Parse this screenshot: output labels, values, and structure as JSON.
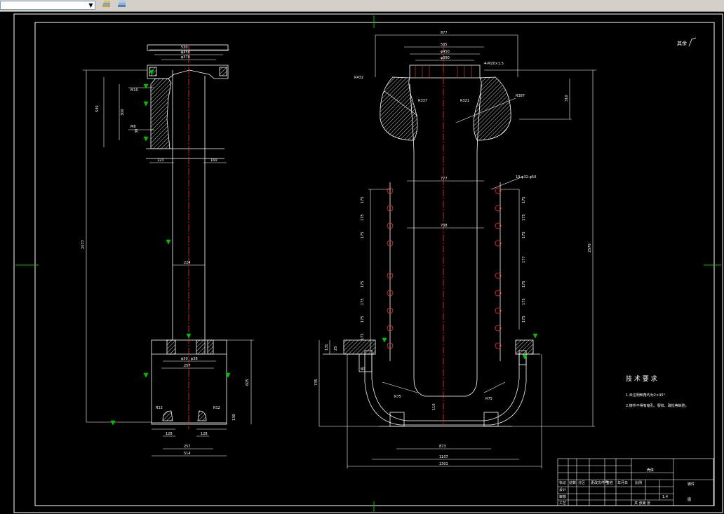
{
  "toolbar": {
    "combo_value": "",
    "layer_icon": "layer-stack-icon",
    "properties_icon": "layer-properties-icon"
  },
  "drawing": {
    "roughness_note": "其余",
    "tech_title": "技 术 要 求",
    "tech_items": [
      "1.未注明倒角均为2×45°",
      "2.铸件不得有缩孔、裂纹、疏松等缺陷。"
    ],
    "left_view": {
      "top_widths": [
        "530",
        "φ450",
        "φ370"
      ],
      "left_dims": [
        "530",
        "300",
        "M10",
        "M8",
        "30"
      ],
      "bottom_top": [
        "123",
        "160"
      ],
      "mid_width": "224",
      "lower_dims": [
        "φ30",
        "φ38",
        "257"
      ],
      "base_dims": [
        "R12",
        "R12",
        "128",
        "128",
        "257",
        "514"
      ],
      "height_dims": [
        "2577",
        "605",
        "130"
      ]
    },
    "right_view": {
      "top_widths": [
        "877",
        "535",
        "φ450",
        "φ390"
      ],
      "note_top": "4-M20×1.5",
      "radii": [
        "R432",
        "R387",
        "R337",
        "R321"
      ],
      "inner_widths": [
        "777",
        "708"
      ],
      "hole_note": "10-φ32-φ50",
      "left_dims": [
        "175",
        "175",
        "175",
        "175",
        "175",
        "175",
        "175"
      ],
      "right_dims": [
        "175",
        "175",
        "175",
        "177",
        "175",
        "175",
        "175"
      ],
      "bottom_dims": [
        "R75",
        "R75",
        "873",
        "1107",
        "1301"
      ],
      "height_dims": [
        "2570",
        "735",
        "310",
        "110"
      ],
      "side_dims": [
        "131",
        "25",
        "80"
      ]
    },
    "title_block": {
      "name": "壳体",
      "scale_label": "比例",
      "scale": "1:4",
      "sheet": "共 张第 张",
      "material": "铸件",
      "rows": [
        "标记",
        "设计",
        "审核",
        "工艺"
      ],
      "cols": [
        "处数",
        "分区",
        "更改文件号",
        "签名",
        "年月日"
      ],
      "company": "图"
    }
  }
}
